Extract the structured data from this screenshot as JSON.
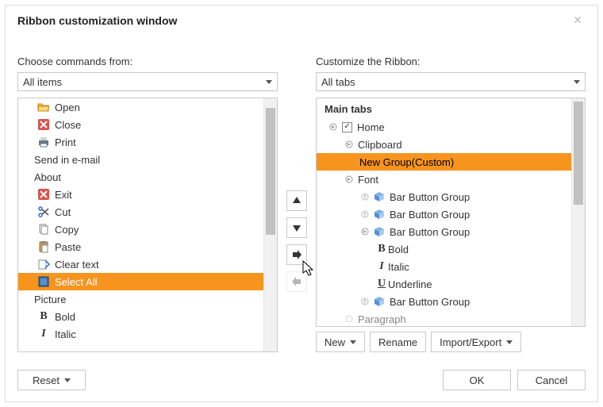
{
  "title": "Ribbon customization window",
  "left": {
    "label": "Choose commands from:",
    "dropdown": "All items",
    "items": [
      {
        "icon": "folder-open",
        "label": "Open",
        "type": "cmd"
      },
      {
        "icon": "close-red",
        "label": "Close",
        "type": "cmd"
      },
      {
        "icon": "printer",
        "label": "Print",
        "type": "cmd"
      },
      {
        "label": "Send in e-mail",
        "type": "group"
      },
      {
        "label": "About",
        "type": "group"
      },
      {
        "icon": "close-red",
        "label": "Exit",
        "type": "cmd"
      },
      {
        "icon": "scissors",
        "label": "Cut",
        "type": "cmd"
      },
      {
        "icon": "copy",
        "label": "Copy",
        "type": "cmd"
      },
      {
        "icon": "paste",
        "label": "Paste",
        "type": "cmd"
      },
      {
        "icon": "clear",
        "label": "Clear text",
        "type": "cmd"
      },
      {
        "icon": "select-all",
        "label": "Select All",
        "type": "cmd",
        "selected": true
      },
      {
        "label": "Picture",
        "type": "group"
      },
      {
        "icon": "bold",
        "label": "Bold",
        "type": "cmd"
      },
      {
        "icon": "italic",
        "label": "Italic",
        "type": "cmd"
      }
    ]
  },
  "right": {
    "label": "Customize the Ribbon:",
    "dropdown": "All tabs",
    "tree_header": "Main tabs",
    "new_group_label": "New Group(Custom)",
    "home": "Home",
    "clipboard": "Clipboard",
    "font": "Font",
    "bbg": "Bar Button Group",
    "bold": "Bold",
    "italic": "Italic",
    "underline": "Underline",
    "paragraph": "Paragraph",
    "btn_new": "New",
    "btn_rename": "Rename",
    "btn_import": "Import/Export"
  },
  "footer": {
    "reset": "Reset",
    "ok": "OK",
    "cancel": "Cancel"
  }
}
